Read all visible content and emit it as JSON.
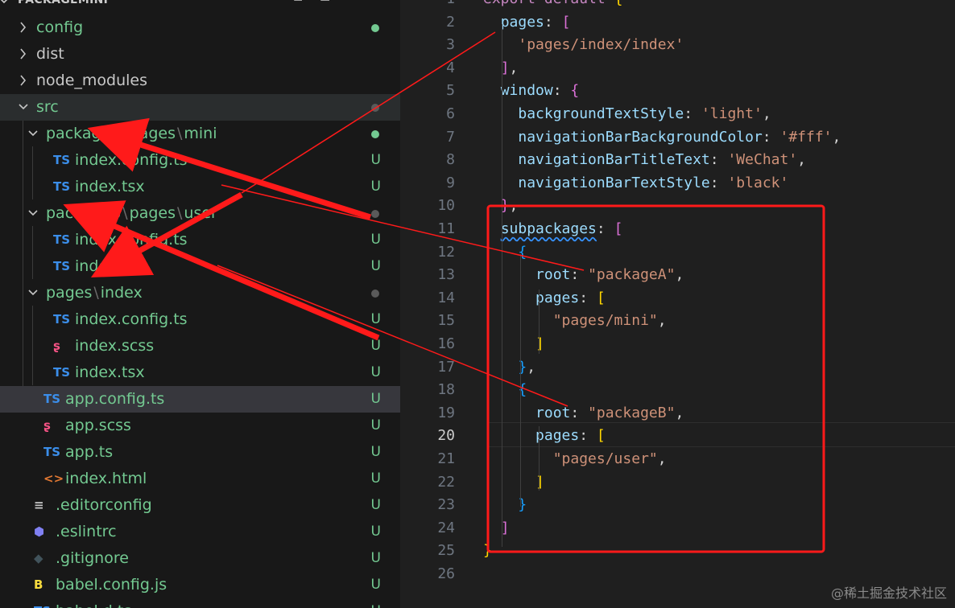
{
  "explorer": {
    "title": "PACKAGEMINI",
    "actions": [
      "new-file-icon",
      "new-folder-icon",
      "refresh-icon",
      "collapse-icon"
    ],
    "items": [
      {
        "label": "config",
        "kind": "folder",
        "open": false,
        "depth": 0,
        "color": "#73c991",
        "dot": "#73c991"
      },
      {
        "label": "dist",
        "kind": "folder",
        "open": false,
        "depth": 0,
        "color": "#c8c8c8"
      },
      {
        "label": "node_modules",
        "kind": "folder",
        "open": false,
        "depth": 0,
        "color": "#c8c8c8"
      },
      {
        "label": "src",
        "kind": "folder",
        "open": true,
        "depth": 0,
        "color": "#73c991",
        "dot": "#5a5a5a"
      },
      {
        "label_parts": [
          "packageA",
          "pages",
          "mini"
        ],
        "kind": "folder",
        "open": true,
        "depth": 1,
        "color": "#73c991",
        "dot": "#73c991"
      },
      {
        "label": "index.config.ts",
        "kind": "ts",
        "depth": 2,
        "badge": "U"
      },
      {
        "label": "index.tsx",
        "kind": "ts",
        "depth": 2,
        "badge": "U"
      },
      {
        "label_parts": [
          "packageB",
          "pages",
          "user"
        ],
        "kind": "folder",
        "open": true,
        "depth": 1,
        "color": "#73c991",
        "dot": "#5a5a5a"
      },
      {
        "label": "index.config.ts",
        "kind": "ts",
        "depth": 2,
        "badge": "U"
      },
      {
        "label": "index.tsx",
        "kind": "ts",
        "depth": 2,
        "badge": "U"
      },
      {
        "label_parts": [
          "pages",
          "index"
        ],
        "kind": "folder",
        "open": true,
        "depth": 1,
        "color": "#73c991",
        "dot": "#5a5a5a"
      },
      {
        "label": "index.config.ts",
        "kind": "ts",
        "depth": 2,
        "badge": "U"
      },
      {
        "label": "index.scss",
        "kind": "scss",
        "depth": 2,
        "badge": "U"
      },
      {
        "label": "index.tsx",
        "kind": "ts",
        "depth": 2,
        "badge": "U"
      },
      {
        "label": "app.config.ts",
        "kind": "ts",
        "depth": 1,
        "badge": "U",
        "selected": true
      },
      {
        "label": "app.scss",
        "kind": "scss",
        "depth": 1,
        "badge": "U"
      },
      {
        "label": "app.ts",
        "kind": "ts",
        "depth": 1,
        "badge": "U"
      },
      {
        "label": "index.html",
        "kind": "html",
        "depth": 1,
        "badge": "U"
      },
      {
        "label": ".editorconfig",
        "kind": "editorconfig",
        "depth": 0,
        "badge": "U"
      },
      {
        "label": ".eslintrc",
        "kind": "eslint",
        "depth": 0,
        "badge": "U"
      },
      {
        "label": ".gitignore",
        "kind": "git",
        "depth": 0,
        "badge": "U"
      },
      {
        "label": "babel.config.js",
        "kind": "babel",
        "depth": 0,
        "badge": "U"
      },
      {
        "label": "babel.d.ts",
        "kind": "ts",
        "depth": 0,
        "badge": "U"
      }
    ]
  },
  "editor": {
    "active_line": 20,
    "lines": [
      {
        "n": 1,
        "tokens": [
          [
            "k",
            "export default "
          ],
          [
            "b3",
            "{"
          ]
        ]
      },
      {
        "n": 2,
        "tokens": [
          [
            "t",
            "  "
          ],
          [
            "p",
            "pages"
          ],
          [
            "t",
            ": "
          ],
          [
            "b1",
            "["
          ]
        ]
      },
      {
        "n": 3,
        "tokens": [
          [
            "t",
            "    "
          ],
          [
            "s",
            "'pages/index/index'"
          ]
        ]
      },
      {
        "n": 4,
        "tokens": [
          [
            "t",
            "  "
          ],
          [
            "b1",
            "]"
          ],
          [
            "t",
            ","
          ]
        ]
      },
      {
        "n": 5,
        "tokens": [
          [
            "t",
            "  "
          ],
          [
            "p",
            "window"
          ],
          [
            "t",
            ": "
          ],
          [
            "b1",
            "{"
          ]
        ]
      },
      {
        "n": 6,
        "tokens": [
          [
            "t",
            "    "
          ],
          [
            "p",
            "backgroundTextStyle"
          ],
          [
            "t",
            ": "
          ],
          [
            "s",
            "'light'"
          ],
          [
            "t",
            ","
          ]
        ]
      },
      {
        "n": 7,
        "tokens": [
          [
            "t",
            "    "
          ],
          [
            "p",
            "navigationBarBackgroundColor"
          ],
          [
            "t",
            ": "
          ],
          [
            "s",
            "'#fff'"
          ],
          [
            "t",
            ","
          ]
        ]
      },
      {
        "n": 8,
        "tokens": [
          [
            "t",
            "    "
          ],
          [
            "p",
            "navigationBarTitleText"
          ],
          [
            "t",
            ": "
          ],
          [
            "s",
            "'WeChat'"
          ],
          [
            "t",
            ","
          ]
        ]
      },
      {
        "n": 9,
        "tokens": [
          [
            "t",
            "    "
          ],
          [
            "p",
            "navigationBarTextStyle"
          ],
          [
            "t",
            ": "
          ],
          [
            "s",
            "'black'"
          ]
        ]
      },
      {
        "n": 10,
        "tokens": [
          [
            "t",
            "  "
          ],
          [
            "b1",
            "}"
          ],
          [
            "t",
            ","
          ]
        ]
      },
      {
        "n": 11,
        "tokens": [
          [
            "t",
            "  "
          ],
          [
            "sq",
            "subpackages"
          ],
          [
            "t",
            ": "
          ],
          [
            "b1",
            "["
          ]
        ]
      },
      {
        "n": 12,
        "tokens": [
          [
            "t",
            "    "
          ],
          [
            "b2",
            "{"
          ]
        ]
      },
      {
        "n": 13,
        "tokens": [
          [
            "t",
            "      "
          ],
          [
            "p",
            "root"
          ],
          [
            "t",
            ": "
          ],
          [
            "s",
            "\"packageA\""
          ],
          [
            "t",
            ","
          ]
        ]
      },
      {
        "n": 14,
        "tokens": [
          [
            "t",
            "      "
          ],
          [
            "p",
            "pages"
          ],
          [
            "t",
            ": "
          ],
          [
            "b3",
            "["
          ]
        ]
      },
      {
        "n": 15,
        "tokens": [
          [
            "t",
            "        "
          ],
          [
            "s",
            "\"pages/mini\""
          ],
          [
            "t",
            ","
          ]
        ]
      },
      {
        "n": 16,
        "tokens": [
          [
            "t",
            "      "
          ],
          [
            "b3",
            "]"
          ]
        ]
      },
      {
        "n": 17,
        "tokens": [
          [
            "t",
            "    "
          ],
          [
            "b2",
            "}"
          ],
          [
            "t",
            ","
          ]
        ]
      },
      {
        "n": 18,
        "tokens": [
          [
            "t",
            "    "
          ],
          [
            "b2",
            "{"
          ]
        ]
      },
      {
        "n": 19,
        "tokens": [
          [
            "t",
            "      "
          ],
          [
            "p",
            "root"
          ],
          [
            "t",
            ": "
          ],
          [
            "s",
            "\"packageB\""
          ],
          [
            "t",
            ","
          ]
        ]
      },
      {
        "n": 20,
        "tokens": [
          [
            "t",
            "      "
          ],
          [
            "p",
            "pages"
          ],
          [
            "t",
            ": "
          ],
          [
            "b3",
            "["
          ]
        ]
      },
      {
        "n": 21,
        "tokens": [
          [
            "t",
            "        "
          ],
          [
            "s",
            "\"pages/user\""
          ],
          [
            "t",
            ","
          ]
        ]
      },
      {
        "n": 22,
        "tokens": [
          [
            "t",
            "      "
          ],
          [
            "b3",
            "]"
          ]
        ]
      },
      {
        "n": 23,
        "tokens": [
          [
            "t",
            "    "
          ],
          [
            "b2",
            "}"
          ]
        ]
      },
      {
        "n": 24,
        "tokens": [
          [
            "t",
            "  "
          ],
          [
            "b1",
            "]"
          ]
        ]
      },
      {
        "n": 25,
        "tokens": [
          [
            "b3",
            "}"
          ]
        ]
      },
      {
        "n": 26,
        "tokens": []
      }
    ]
  },
  "watermark": "@稀土掘金技术社区",
  "colors": {
    "annotation": "#ff1a1a",
    "untracked": "#73c991"
  }
}
